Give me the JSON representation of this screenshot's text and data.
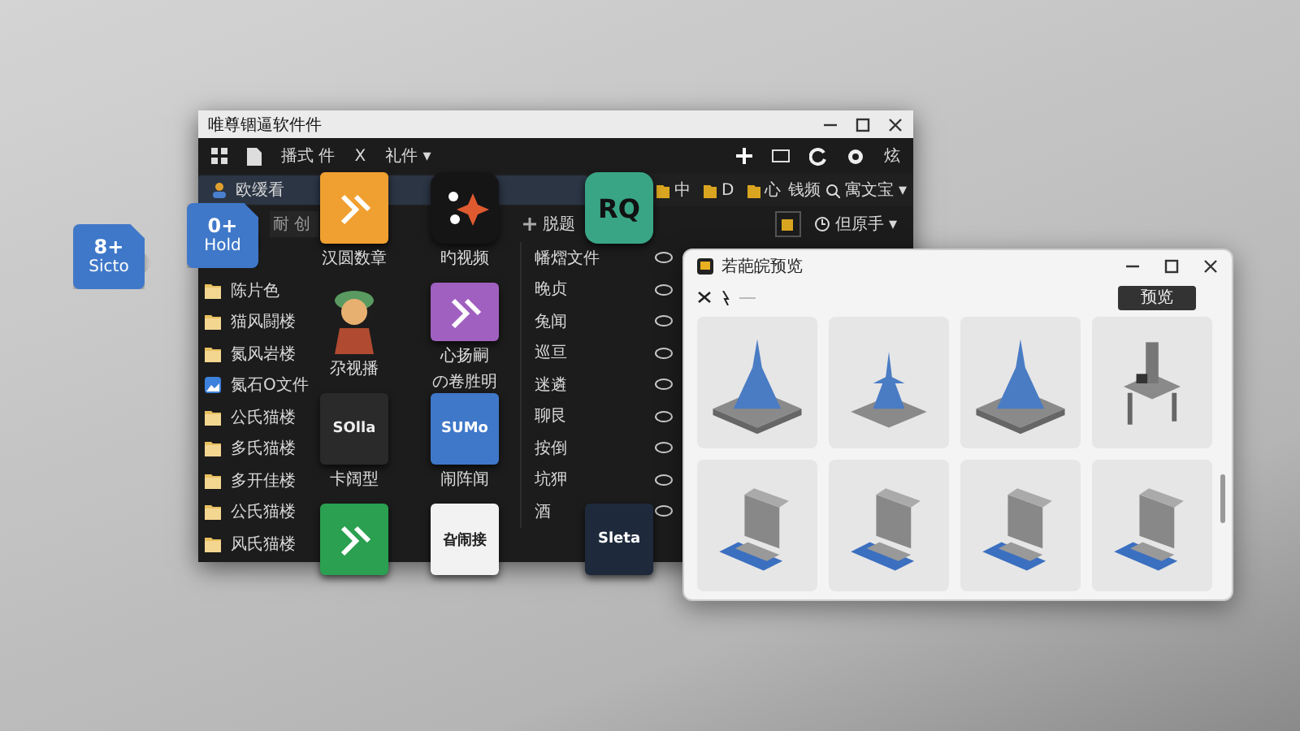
{
  "desktop_icons": [
    {
      "glyph": "8+",
      "label": "Sicto"
    },
    {
      "glyph": "0+",
      "label": "Hold"
    }
  ],
  "main_window": {
    "title": "唯尊锢逼软件件",
    "toolbar": [
      "播式 件",
      "X",
      "礼件 ▾"
    ],
    "toolbar_end": "炫",
    "nav_item": {
      "label": "欧缓看",
      "selected": true
    },
    "tabs": [
      "中",
      "D",
      "心"
    ],
    "search": {
      "label": "钱频",
      "value": "寓文宝 ▾"
    },
    "filter": {
      "placeholder": "耐 创"
    },
    "add_label": "脱题",
    "sort_label": "但原手 ▾",
    "files": [
      {
        "kind": "folder",
        "name": "陈片色"
      },
      {
        "kind": "folder",
        "name": "猫风闘楼"
      },
      {
        "kind": "folder",
        "name": "氮风岩楼"
      },
      {
        "kind": "image",
        "name": "氮石O文件"
      },
      {
        "kind": "folder",
        "name": "公氏猫楼"
      },
      {
        "kind": "folder",
        "name": "多氏猫楼"
      },
      {
        "kind": "folder",
        "name": "多开佳楼"
      },
      {
        "kind": "folder",
        "name": "公氏猫楼"
      },
      {
        "kind": "folder",
        "name": "风氏猫楼"
      }
    ],
    "items": [
      "幡熠文件",
      "晚贞",
      "兔闻",
      "巡亘",
      "迷遴",
      "聊艮",
      "按倒",
      "坑狎",
      "酒"
    ],
    "apps": [
      {
        "kind": "orange",
        "labels": [
          "汉圆数章"
        ]
      },
      {
        "kind": "sparkle",
        "labels": [
          "旳视频"
        ]
      },
      {
        "kind": "teal",
        "text": "RQ"
      },
      {
        "kind": "figure",
        "labels": [
          "尕视播"
        ]
      },
      {
        "kind": "purple",
        "labels": [
          "心扬嗣",
          "の卷胜明"
        ]
      },
      {
        "kind": "none"
      },
      {
        "kind": "dark",
        "text": "SOlla",
        "labels": [
          "卡阔型"
        ]
      },
      {
        "kind": "blue",
        "text": "SUMo",
        "labels": [
          "闹阵闻"
        ]
      },
      {
        "kind": "none"
      },
      {
        "kind": "green"
      },
      {
        "kind": "white",
        "text": "旮闹接"
      },
      {
        "kind": "darksq",
        "text": "Sleta"
      }
    ]
  },
  "preview_window": {
    "title": "若葩皖预览",
    "button": "预览",
    "tiles": [
      {
        "kind": "spire"
      },
      {
        "kind": "spire-small"
      },
      {
        "kind": "spire"
      },
      {
        "kind": "rig"
      },
      {
        "kind": "machine"
      },
      {
        "kind": "machine"
      },
      {
        "kind": "machine"
      },
      {
        "kind": "machine"
      }
    ]
  }
}
